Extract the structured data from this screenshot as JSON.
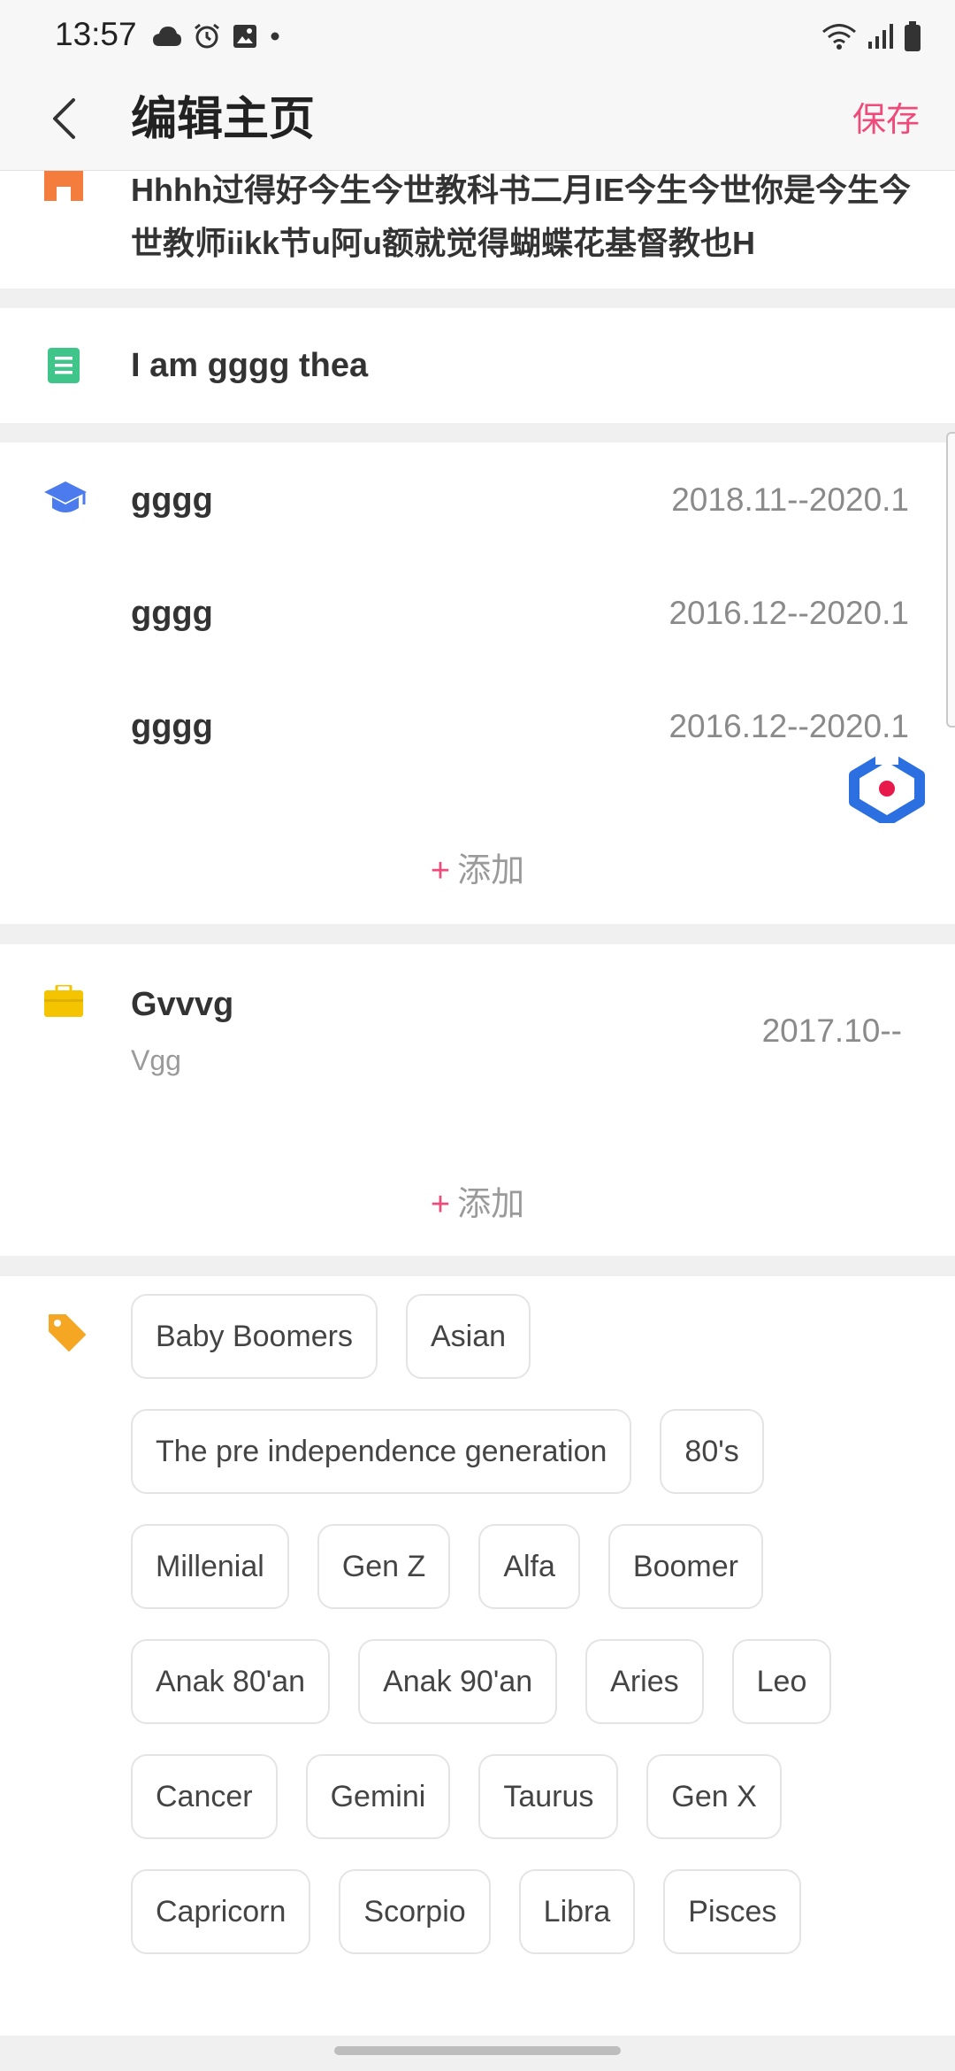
{
  "status_bar": {
    "time": "13:57"
  },
  "header": {
    "title": "编辑主页",
    "save_label": "保存"
  },
  "school_section": {
    "text": "Hhhh过得好今生今世教科书二月IE今生今世你是今生今世教师iikk节u阿u额就觉得蝴蝶花基督教也H"
  },
  "intro_section": {
    "text": "I am gggg thea"
  },
  "education": {
    "items": [
      {
        "name": "gggg",
        "date": "2018.11--2020.1"
      },
      {
        "name": "gggg",
        "date": "2016.12--2020.1"
      },
      {
        "name": "gggg",
        "date": "2016.12--2020.1"
      }
    ],
    "add_label": "添加"
  },
  "work": {
    "title": "Gvvvg",
    "subtitle": "Vgg",
    "date": "2017.10--",
    "add_label": "添加"
  },
  "tags": {
    "rows": [
      [
        "Baby Boomers",
        "Asian"
      ],
      [
        "The pre independence generation",
        "80's"
      ],
      [
        "Millenial",
        "Gen Z",
        "Alfa",
        "Boomer"
      ],
      [
        "Anak 80'an",
        "Anak 90'an",
        "Aries",
        "Leo"
      ],
      [
        "Cancer",
        "Gemini",
        "Taurus",
        "Gen X"
      ],
      [
        "Capricorn",
        "Scorpio",
        "Libra",
        "Pisces"
      ]
    ]
  },
  "colors": {
    "accent": "#ee4a7a",
    "school_icon": "#f47c3c",
    "intro_icon": "#3fc48a",
    "edu_icon": "#4b7bec",
    "work_icon": "#f5c400",
    "tag_icon": "#f5a623"
  }
}
